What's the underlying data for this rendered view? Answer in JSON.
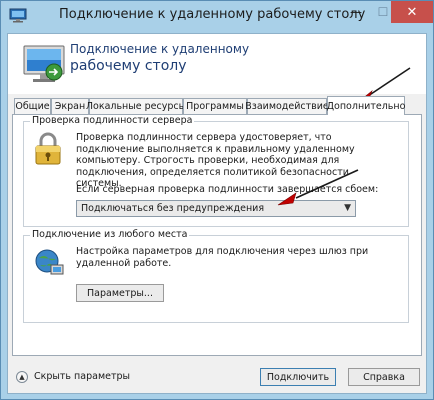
{
  "window": {
    "title": "Подключение к удаленному рабочему столу",
    "minimize": "—",
    "maximize": "☐",
    "close": "✕"
  },
  "header": {
    "line1": "Подключение к удаленному",
    "line2": "рабочему столу"
  },
  "tabs": [
    {
      "label": "Общие"
    },
    {
      "label": "Экран"
    },
    {
      "label": "Локальные ресурсы"
    },
    {
      "label": "Программы"
    },
    {
      "label": "Взаимодействие"
    },
    {
      "label": "Дополнительно",
      "active": true
    }
  ],
  "server_auth": {
    "title": "Проверка подлинности сервера",
    "description": "Проверка подлинности сервера удостоверяет, что подключение выполняется к правильному удаленному компьютеру. Строгость проверки, необходимая для подключения, определяется политикой безопасности системы.",
    "select_label": "Если серверная проверка подлинности завершается сбоем:",
    "select_value": "Подключаться без предупреждения",
    "icon": "lock-icon"
  },
  "connect_anywhere": {
    "title": "Подключение из любого места",
    "description": "Настройка параметров для подключения через шлюз при удаленной работе.",
    "button_label": "Параметры...",
    "icon": "globe-network-icon"
  },
  "footer": {
    "hide_options": "Скрыть параметры",
    "connect": "Подключить",
    "help": "Справка"
  },
  "colors": {
    "titlebar": "#a9d0e8",
    "close_button": "#c7504b",
    "header_text": "#1f3e74",
    "annotation_arrow": "#c00000"
  }
}
